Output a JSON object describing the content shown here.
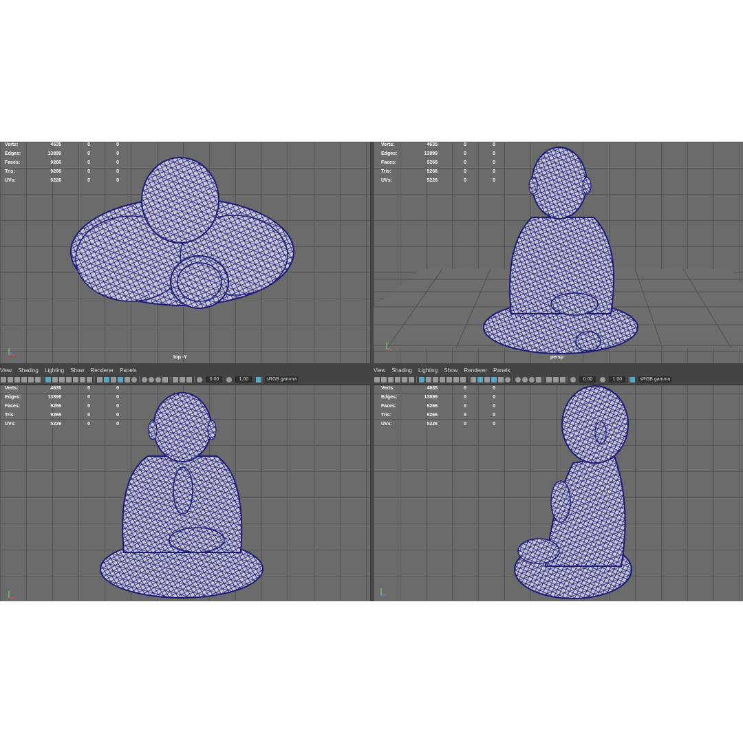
{
  "menus": [
    "View",
    "Shading",
    "Lighting",
    "Show",
    "Renderer",
    "Panels"
  ],
  "toolbar": {
    "exposure": "0.00",
    "gamma": "1.00",
    "color_space": "sRGB gamma"
  },
  "hud": {
    "rows": [
      {
        "label": "Verts:",
        "values": [
          "4635",
          "0",
          "0"
        ]
      },
      {
        "label": "Edges:",
        "values": [
          "13899",
          "0",
          "0"
        ]
      },
      {
        "label": "Faces:",
        "values": [
          "9266",
          "0",
          "0"
        ]
      },
      {
        "label": "Tris:",
        "values": [
          "9266",
          "0",
          "0"
        ]
      },
      {
        "label": "UVs:",
        "values": [
          "5226",
          "0",
          "0"
        ]
      }
    ]
  },
  "viewports": [
    {
      "camera": "top -Y"
    },
    {
      "camera": "persp"
    },
    {
      "camera": ""
    },
    {
      "camera": ""
    }
  ],
  "colors": {
    "viewport_bg": "#6b6b6b",
    "grid": "#555555",
    "wireframe": "#1c1c78",
    "mesh_fill": "#c8c8d6",
    "selected_icon": "#5aa6c8"
  },
  "icons": [
    "camera-icon",
    "grid-icon",
    "wireframe-shading-icon",
    "smooth-shading-icon",
    "lighting-icon",
    "shadow-icon",
    "isolate-icon",
    "xray-icon",
    "exposure-icon",
    "gamma-icon",
    "color-management-icon"
  ]
}
